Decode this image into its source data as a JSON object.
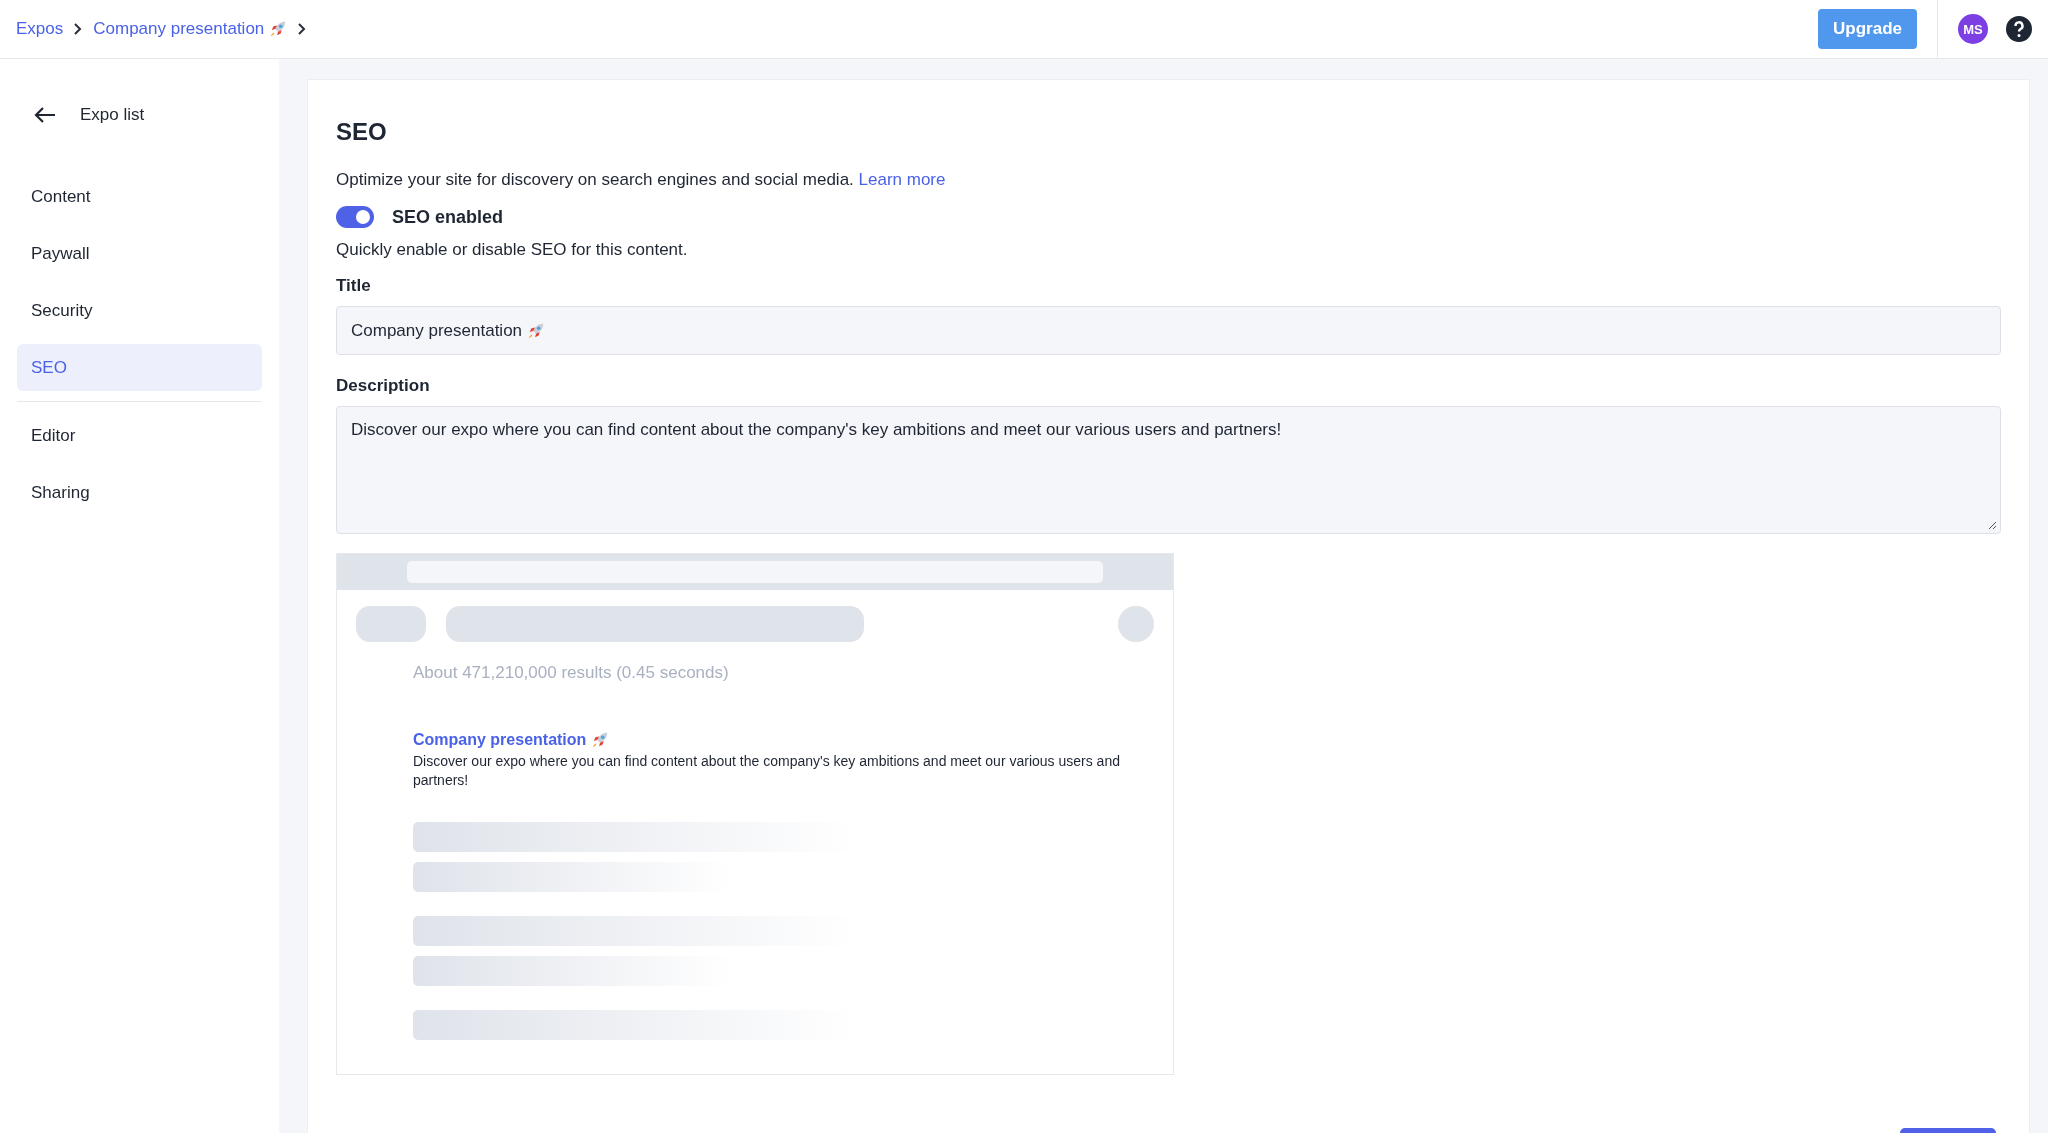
{
  "breadcrumbs": [
    {
      "label": "Expos"
    },
    {
      "label": "Company presentation"
    }
  ],
  "topbar": {
    "upgrade_button": "Upgrade",
    "avatar": "MS"
  },
  "sidebar": {
    "back_link": "Expo list",
    "sections": [
      {
        "items": [
          {
            "label": "Content",
            "selected": false
          },
          {
            "label": "Paywall",
            "selected": false
          },
          {
            "label": "Security",
            "selected": false
          },
          {
            "label": "SEO",
            "selected": true
          }
        ]
      },
      {
        "items": [
          {
            "label": "Editor",
            "selected": false
          },
          {
            "label": "Sharing",
            "selected": false
          }
        ]
      }
    ]
  },
  "seo": {
    "heading": "SEO",
    "intro": "Optimize your site for discovery on search engines and social media.",
    "learn_more": "Learn more",
    "toggle": {
      "label": "SEO enabled",
      "on": true
    },
    "toggle_hint": "Quickly enable or disable SEO for this content.",
    "title_field": {
      "label": "Title",
      "value": "Company presentation"
    },
    "description_field": {
      "label": "Description",
      "value": "Discover our expo where you can find content about the company's key ambitions and meet our various users and partners!"
    },
    "preview": {
      "results_count": "About 471,210,000 results (0.45 seconds)",
      "result_title": "Company presentation",
      "result_description": "Discover our expo where you can find content about the company's key ambitions and meet our various users and partners!"
    }
  }
}
